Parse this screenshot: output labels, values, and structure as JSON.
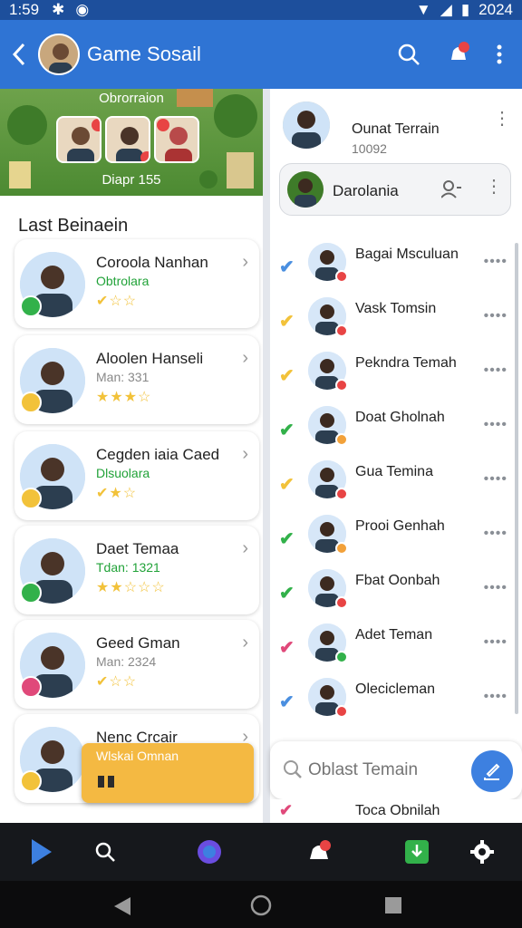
{
  "status": {
    "time": "1:59",
    "year": "2024"
  },
  "appbar": {
    "title": "Game Sosail"
  },
  "banner": {
    "top_text": "Obrorraion",
    "bottom_text": "Diapr 155"
  },
  "section_title": "Last Beinaein",
  "left_cards": [
    {
      "name": "Coroola Nanhan",
      "sub": "Obtrolara",
      "sub_color": "#21a238",
      "rating": "✔☆☆",
      "badge_color": "#32b14a"
    },
    {
      "name": "Aloolen Hanseli",
      "sub": "Man: 331",
      "sub_color": "#888888",
      "rating": "★★★☆",
      "badge_color": "#f2c23a"
    },
    {
      "name": "Cegden iaia Caed",
      "sub": "Dlsuolara",
      "sub_color": "#21a238",
      "rating": "✔★☆",
      "badge_color": "#f2c23a"
    },
    {
      "name": "Daet Temaa",
      "sub": "Tdan: 1321",
      "sub_color": "#21a238",
      "rating": "★★☆☆☆",
      "badge_color": "#32b14a"
    },
    {
      "name": "Geed Gman",
      "sub": "Man: 2324",
      "sub_color": "#888888",
      "rating": "✔☆☆",
      "badge_color": "#e0497a"
    },
    {
      "name": "Nenc Crcair",
      "sub": "",
      "sub_color": "#888888",
      "rating": "",
      "badge_color": "#f2c23a"
    }
  ],
  "popup": {
    "text": "Wlskai Omnan"
  },
  "right": {
    "profile": {
      "name": "Ounat Terrain",
      "sub": "10092"
    },
    "pill": {
      "name": "Darolania"
    },
    "friends": [
      {
        "name": "Bagai Msculuan",
        "check_color": "#4a8fe0",
        "badge": "#e84444"
      },
      {
        "name": "Vask Tomsin",
        "check_color": "#f2c23a",
        "badge": "#e84444"
      },
      {
        "name": "Pekndra Temah",
        "check_color": "#f2c23a",
        "badge": "#e84444"
      },
      {
        "name": "Doat Gholnah",
        "check_color": "#32b14a",
        "badge": "#f2a13a"
      },
      {
        "name": "Gua Temina",
        "check_color": "#f2c23a",
        "badge": "#e84444"
      },
      {
        "name": "Prooi Genhah",
        "check_color": "#32b14a",
        "badge": "#f2a13a"
      },
      {
        "name": "Fbat Oonbah",
        "check_color": "#32b14a",
        "badge": "#e84444"
      },
      {
        "name": "Adet Teman",
        "check_color": "#e0497a",
        "badge": "#32b14a"
      },
      {
        "name": "Olecicleman",
        "check_color": "#4a8fe0",
        "badge": "#e84444"
      }
    ],
    "peek": {
      "name": "Toca Obnilah"
    },
    "search_placeholder": "Oblast Temain"
  },
  "bottom_nav": [
    "play-icon",
    "search-icon",
    "chat-icon",
    "notification-icon",
    "download-icon",
    "settings-icon"
  ]
}
